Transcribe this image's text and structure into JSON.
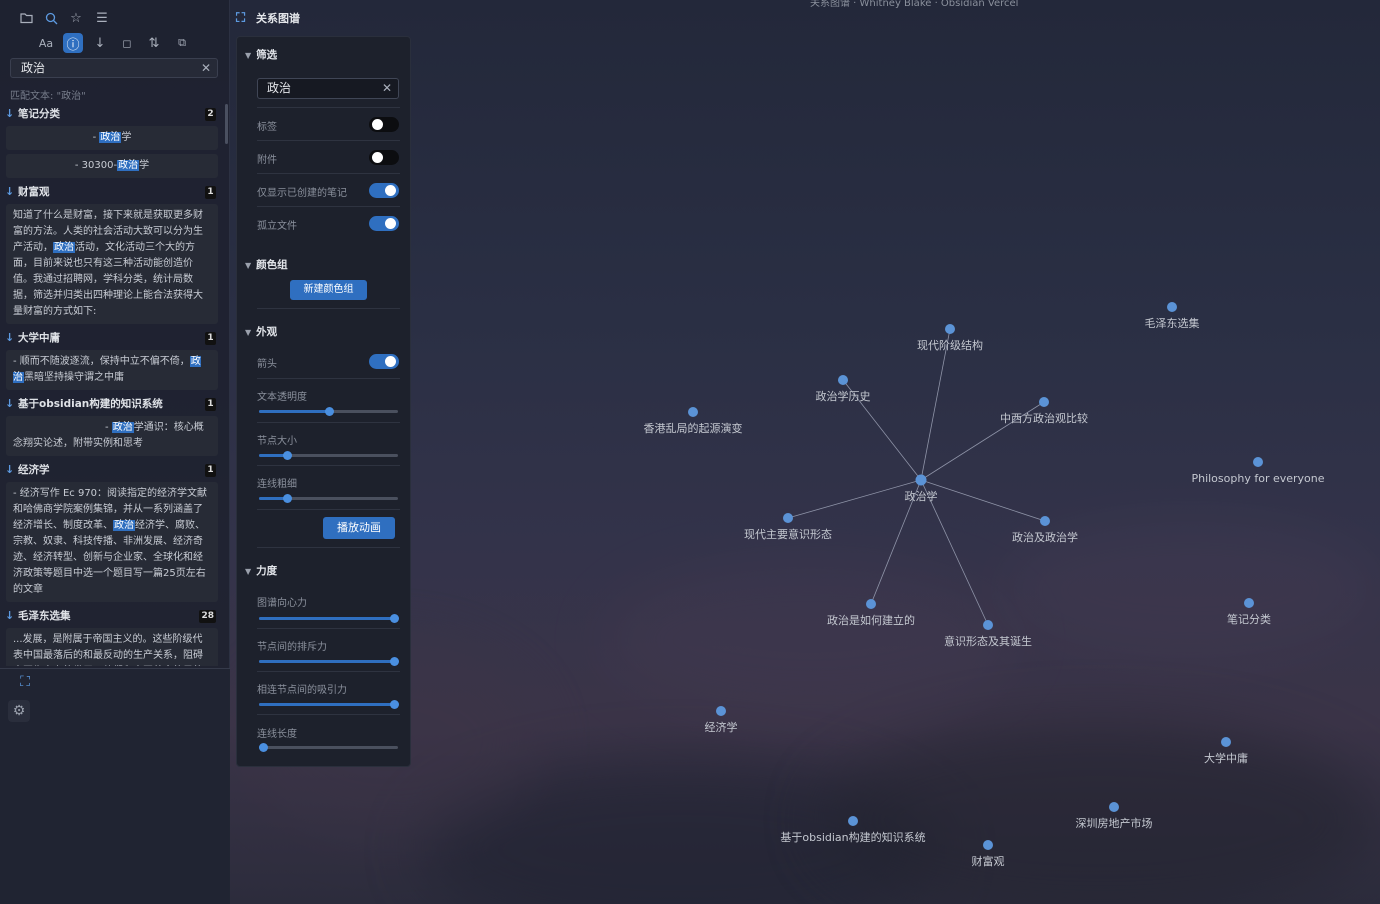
{
  "sidebar": {
    "search_value": "政治",
    "match_text": "匹配文本: \"政治\"",
    "groups": [
      {
        "title": "笔记分类",
        "count": "2",
        "cards": [
          {
            "parts": [
              "- ",
              "政治",
              "学"
            ]
          },
          {
            "parts": [
              "- 30300-",
              "政治",
              "学"
            ]
          }
        ]
      },
      {
        "title": "财富观",
        "count": "1",
        "cards": [
          {
            "parts": [
              "知道了什么是财富，接下来就是获取更多财富的方法。人类的社会活动大致可以分为生产活动，",
              "政治",
              "活动，文化活动三个大的方面，目前来说也只有这三种活动能创造价值。我通过招聘网，学科分类，统计局数据，筛选并归类出四种理论上能合法获得大量财富的方式如下:"
            ]
          }
        ]
      },
      {
        "title": "大学中庸",
        "count": "1",
        "cards": [
          {
            "parts": [
              "- 顺而不随波逐流，保持中立不偏不倚，",
              "政治",
              "黑暗坚持操守谓之中庸"
            ]
          }
        ]
      },
      {
        "title": "基于obsidian构建的知识系统",
        "count": "1",
        "cards": [
          {
            "parts": [
              "- ",
              "政治",
              "学通识：核心概念翔实论述，附带实例和思考"
            ]
          }
        ]
      },
      {
        "title": "经济学",
        "count": "1",
        "cards": [
          {
            "parts": [
              "- 经济写作 Ec 970：阅读指定的经济学文献和哈佛商学院案例集锦，并从一系列涵盖了经济增长、制度改革、",
              "政治",
              "经济学、腐败、宗教、奴隶、科技传播、非洲发展、经济奇迹、经济转型、创新与企业家、全球化和经济政策等题目中选一个题目写一篇25页左右的文章"
            ]
          }
        ]
      },
      {
        "title": "毛泽东选集",
        "count": "28",
        "cards": [
          {
            "parts": [
              "...发展，是附属于帝国主义的。这些阶级代表中国最落后的和最反动的生产关系，阻碍中国生产力的发展。他们和中国革命的目的完全不相容。特别是大地主阶级和大买办阶级",
              "",
              ""
            ]
          }
        ]
      }
    ]
  },
  "graph_view": {
    "title": "关系图谱",
    "top_hint": "关系图谱 · Whitney Blake · Obsidian Vercel",
    "filter": {
      "section": "筛选",
      "search_value": "政治",
      "tags_label": "标签",
      "tags_on": false,
      "attachments_label": "附件",
      "attachments_on": false,
      "existing_only_label": "仅显示已创建的笔记",
      "existing_only_on": true,
      "orphans_label": "孤立文件",
      "orphans_on": true
    },
    "groups": {
      "section": "颜色组",
      "new_group_button": "新建颜色组"
    },
    "display": {
      "section": "外观",
      "arrows_label": "箭头",
      "arrows_on": true,
      "text_fade_label": "文本透明度",
      "text_fade": 0.5,
      "node_size_label": "节点大小",
      "node_size": 0.2,
      "link_thickness_label": "连线粗细",
      "link_thickness": 0.2,
      "animate_button": "播放动画"
    },
    "forces": {
      "section": "力度",
      "center_label": "图谱向心力",
      "center": 0.97,
      "repel_label": "节点间的排斥力",
      "repel": 0.97,
      "link_force_label": "相连节点间的吸引力",
      "link_force": 0.97,
      "link_distance_label": "连线长度",
      "link_distance": 0.03
    },
    "nodes": [
      {
        "id": "zzx",
        "label": "政治学"
      },
      {
        "id": "xdjjjg",
        "label": "现代阶级结构"
      },
      {
        "id": "zzxls",
        "label": "政治学历史"
      },
      {
        "id": "zxfzzgbj",
        "label": "中西方政治观比较"
      },
      {
        "id": "xdzyysxt",
        "label": "现代主要意识形态"
      },
      {
        "id": "zzjzzx",
        "label": "政治及政治学"
      },
      {
        "id": "zzsrhjld",
        "label": "政治是如何建立的"
      },
      {
        "id": "ysxtjqdr",
        "label": "意识形态及其诞生"
      },
      {
        "id": "xgllqy",
        "label": "香港乱局的起源演变"
      },
      {
        "id": "mzdxj",
        "label": "毛泽东选集"
      },
      {
        "id": "pfe",
        "label": "Philosophy for everyone"
      },
      {
        "id": "bjfl",
        "label": "笔记分类"
      },
      {
        "id": "jjx",
        "label": "经济学"
      },
      {
        "id": "dxzy",
        "label": "大学中庸"
      },
      {
        "id": "szfdcsc",
        "label": "深圳房地产市场"
      },
      {
        "id": "obs",
        "label": "基于obsidian构建的知识系统"
      },
      {
        "id": "cfg",
        "label": "财富观"
      }
    ],
    "links": [
      [
        "zzx",
        "xdjjjg"
      ],
      [
        "zzx",
        "zzxls"
      ],
      [
        "zzx",
        "zxfzzgbj"
      ],
      [
        "zzx",
        "xdzyysxt"
      ],
      [
        "zzx",
        "zzjzzx"
      ],
      [
        "zzx",
        "zzsrhjld"
      ],
      [
        "zzx",
        "ysxtjqdr"
      ]
    ]
  },
  "colors": {
    "accent": "#2f6fc0",
    "node": "#5b93d6",
    "link": "#8f94a8"
  }
}
